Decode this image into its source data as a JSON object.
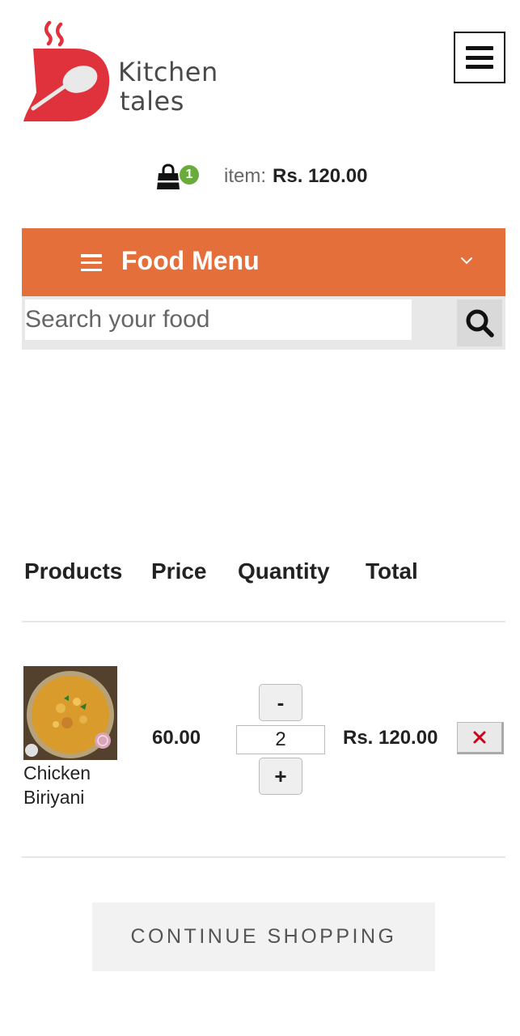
{
  "logo": {
    "line1": "Kitchen",
    "line2": "tales",
    "brand_color": "#e0323c"
  },
  "header": {
    "menu_icon": "hamburger-icon"
  },
  "cart_summary": {
    "badge_count": "1",
    "item_label": "item:",
    "item_total": "Rs. 120.00",
    "icon": "shopping-bag-icon",
    "badge_color": "#6aac3b"
  },
  "food_menu": {
    "title": "Food Menu",
    "accent": "#e46f3a",
    "icon": "hamburger-icon",
    "toggle_icon": "chevron-down-icon"
  },
  "search": {
    "placeholder": "Search your food",
    "value": "",
    "icon": "search-icon"
  },
  "cart_table": {
    "headers": [
      "Products",
      "Price",
      "Quantity",
      "Total"
    ],
    "rows": [
      {
        "product": "Chicken Biriyani",
        "price": "60.00",
        "quantity": "2",
        "total": "Rs. 120.00",
        "decrease_label": "-",
        "increase_label": "+",
        "remove_icon": "close-icon"
      }
    ]
  },
  "continue_button": {
    "label": "CONTINUE SHOPPING"
  }
}
